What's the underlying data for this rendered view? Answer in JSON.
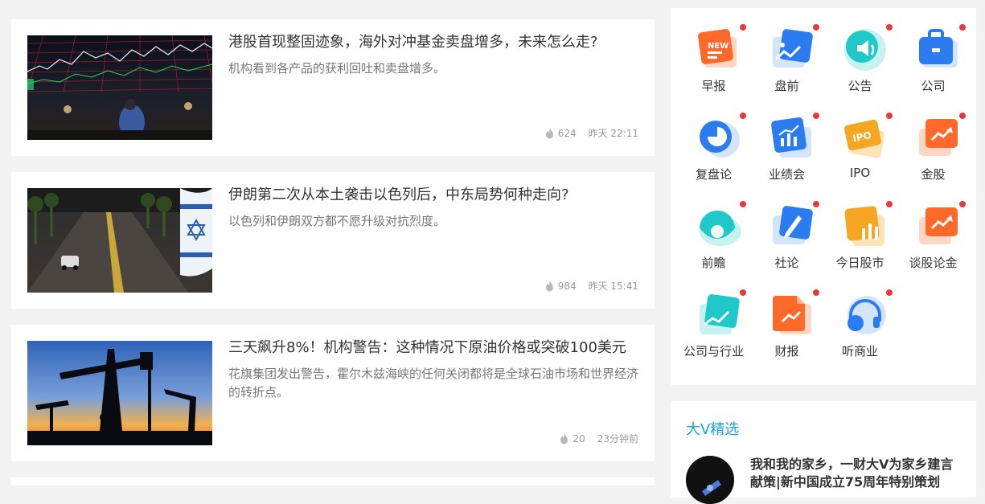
{
  "articles": [
    {
      "title": "港股首现整固迹象，海外对冲基金卖盘增多，未来怎么走?",
      "summary": "机构看到各产品的获利回吐和卖盘增多。",
      "views": "624",
      "time": "昨天 22:11"
    },
    {
      "title": "伊朗第二次从本土袭击以色列后，中东局势何种走向?",
      "summary": "以色列和伊朗双方都不愿升级对抗烈度。",
      "views": "984",
      "time": "昨天 15:41"
    },
    {
      "title": "三天飙升8%！机构警告：这种情况下原油价格或突破100美元",
      "summary": "花旗集团发出警告，霍尔木兹海峡的任何关闭都将是全球石油市场和世界经济的转折点。",
      "views": "20",
      "time": "23分钟前"
    }
  ],
  "categories": [
    {
      "label": "早报",
      "icon": "newspaper-icon",
      "color": "#ff6a2b"
    },
    {
      "label": "盘前",
      "icon": "image-chart-icon",
      "color": "#2b7cf0"
    },
    {
      "label": "公告",
      "icon": "speaker-icon",
      "color": "#1fc9c9"
    },
    {
      "label": "公司",
      "icon": "briefcase-icon",
      "color": "#2b7cf0"
    },
    {
      "label": "复盘论",
      "icon": "pie-chart-icon",
      "color": "#2b7cf0"
    },
    {
      "label": "业绩会",
      "icon": "bar-chart-icon",
      "color": "#2b7cf0"
    },
    {
      "label": "IPO",
      "icon": "ipo-ticket-icon",
      "color": "#f5a623"
    },
    {
      "label": "金股",
      "icon": "gold-stock-icon",
      "color": "#ff6a2b"
    },
    {
      "label": "前瞻",
      "icon": "eye-icon",
      "color": "#1fc9c9"
    },
    {
      "label": "社论",
      "icon": "pen-icon",
      "color": "#2b7cf0"
    },
    {
      "label": "今日股市",
      "icon": "stock-bars-icon",
      "color": "#f5a623"
    },
    {
      "label": "谈股论金",
      "icon": "talk-stock-icon",
      "color": "#ff6a2b"
    },
    {
      "label": "公司与行业",
      "icon": "industry-chart-icon",
      "color": "#1fc9c9"
    },
    {
      "label": "财报",
      "icon": "report-icon",
      "color": "#ff6a2b"
    },
    {
      "label": "听商业",
      "icon": "headphones-icon",
      "color": "#2b7cf0"
    }
  ],
  "featured": {
    "title": "大V精选",
    "item_text": "我和我的家乡，一财大V为家乡建言献策|新中国成立75周年特别策划"
  }
}
